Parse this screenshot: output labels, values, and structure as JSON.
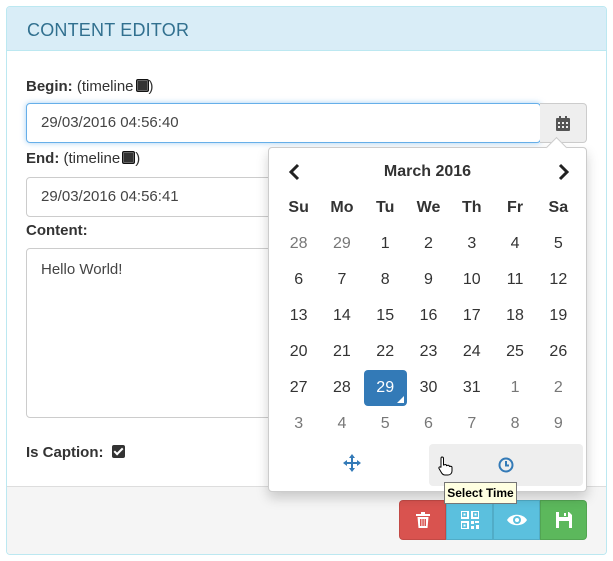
{
  "header": {
    "title": "CONTENT EDITOR"
  },
  "begin": {
    "label": "Begin:",
    "note_prefix": "(timeline",
    "note_suffix": ")",
    "value": "29/03/2016 04:56:40"
  },
  "end": {
    "label": "End:",
    "note_prefix": "(timeline",
    "note_suffix": ")",
    "value": "29/03/2016 04:56:41"
  },
  "content": {
    "label": "Content:",
    "value": "Hello World!"
  },
  "caption": {
    "label": "Is Caption:",
    "checked": true
  },
  "datepicker": {
    "month_title": "March 2016",
    "weekdays": [
      "Su",
      "Mo",
      "Tu",
      "We",
      "Th",
      "Fr",
      "Sa"
    ],
    "weeks": [
      [
        "28",
        "29",
        "1",
        "2",
        "3",
        "4",
        "5"
      ],
      [
        "6",
        "7",
        "8",
        "9",
        "10",
        "11",
        "12"
      ],
      [
        "13",
        "14",
        "15",
        "16",
        "17",
        "18",
        "19"
      ],
      [
        "20",
        "21",
        "22",
        "23",
        "24",
        "25",
        "26"
      ],
      [
        "27",
        "28",
        "29",
        "30",
        "31",
        "1",
        "2"
      ],
      [
        "3",
        "4",
        "5",
        "6",
        "7",
        "8",
        "9"
      ]
    ],
    "selected": "29",
    "tooltip": "Select Time"
  },
  "buttons": {
    "delete_icon": "trash-icon",
    "qr_icon": "qrcode-icon",
    "preview_icon": "eye-icon",
    "save_icon": "floppy-disk-icon"
  },
  "colors": {
    "heading_bg": "#d9edf7",
    "heading_text": "#31708f",
    "selected_day": "#337ab7",
    "danger": "#d9534f",
    "info": "#5bc0de",
    "success": "#5cb85c"
  }
}
